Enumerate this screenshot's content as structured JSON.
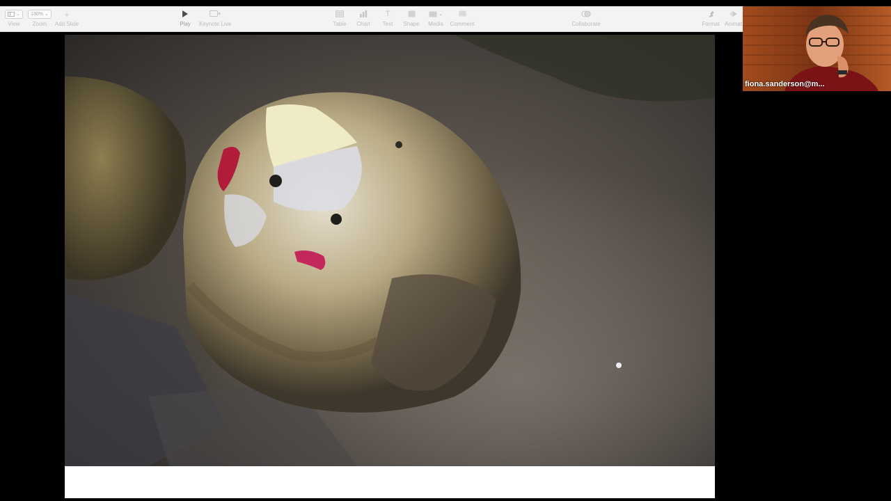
{
  "toolbar": {
    "view": {
      "label": "View",
      "icon": "sidebar-view-icon"
    },
    "zoom": {
      "label": "Zoom",
      "value": "130%",
      "icon": "zoom-menu"
    },
    "add_slide": {
      "label": "Add Slide",
      "icon": "plus-icon"
    },
    "play": {
      "label": "Play",
      "icon": "play-icon"
    },
    "keynote_live": {
      "label": "Keynote Live",
      "icon": "keynote-live-icon"
    },
    "table": {
      "label": "Table",
      "icon": "table-icon"
    },
    "chart": {
      "label": "Chart",
      "icon": "chart-icon"
    },
    "text": {
      "label": "Text",
      "icon": "text-icon"
    },
    "shape": {
      "label": "Shape",
      "icon": "shape-icon"
    },
    "media": {
      "label": "Media",
      "icon": "media-icon"
    },
    "comment": {
      "label": "Comment",
      "icon": "comment-icon"
    },
    "collaborate": {
      "label": "Collaborate",
      "icon": "collaborate-icon"
    },
    "format": {
      "label": "Format",
      "icon": "format-brush-icon"
    },
    "animate": {
      "label": "Animat",
      "icon": "animate-icon"
    }
  },
  "slide": {
    "image": "barnacle-covered shell on wet rock with red paint marks"
  },
  "video": {
    "participant_name": "fiona.sanderson@m..."
  },
  "colors": {
    "toolbar_bg": "#f3f3f3",
    "background": "#000000",
    "slide_bg": "#ffffff"
  }
}
